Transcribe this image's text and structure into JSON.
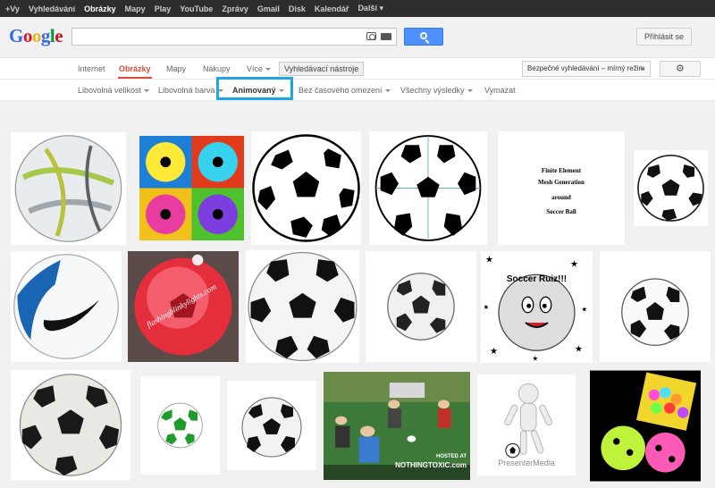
{
  "topbar": {
    "links": [
      "+Vy",
      "Vyhledávání",
      "Obrázky",
      "Mapy",
      "Play",
      "YouTube",
      "Zprávy",
      "Gmail",
      "Disk",
      "Kalendář",
      "Další ▾"
    ],
    "active_index": 2
  },
  "header": {
    "logo_letters": [
      "G",
      "o",
      "o",
      "g",
      "l",
      "e"
    ],
    "logo_colors": [
      "#3369e8",
      "#d50f25",
      "#eeb211",
      "#3369e8",
      "#009925",
      "#d50f25"
    ],
    "search_value": "",
    "signin_label": "Přihlásit se"
  },
  "nav": {
    "tabs": [
      "Internet",
      "Obrázky",
      "Mapy",
      "Nákupy",
      "Více"
    ],
    "active_tab": "Obrázky",
    "tools_label": "Vyhledávací nástroje",
    "safesearch_label": "Bezpečné vyhledávání – mírný režim"
  },
  "filters": {
    "items": [
      "Libovolná velikost",
      "Libovolná barva",
      "Animovaný",
      "Bez časového omezení",
      "Všechny výsledky",
      "Vymazat"
    ],
    "selected": "Animovaný"
  },
  "results": {
    "captions": {
      "fem_lines": [
        "Finite Element",
        "Mesh Generation",
        "around",
        "Soccer Ball"
      ],
      "flashing": "flashingblinkylights.com",
      "soccer_ruiz": "Soccer Ruiz!!!",
      "nothingtoxic": "NOTHINGTOXIC.com",
      "hosted_at": "HOSTED AT",
      "presenter": "PresenterMedia"
    }
  },
  "colors": {
    "accent_red": "#dd4b39",
    "search_blue": "#4d90fe",
    "highlight_blue": "#1fa5e6"
  }
}
